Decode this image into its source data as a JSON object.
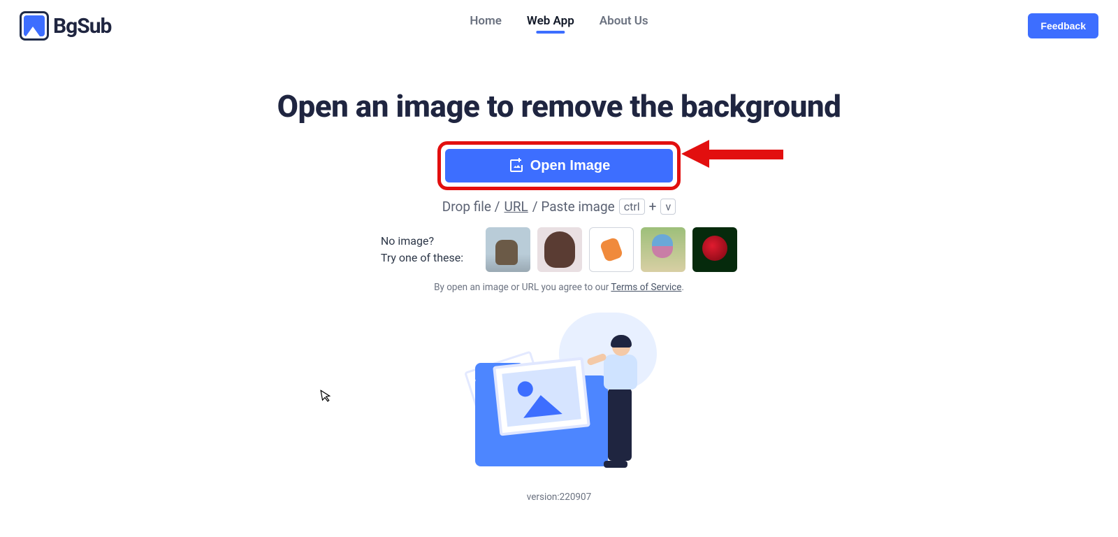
{
  "brand": {
    "name": "BgSub"
  },
  "nav": {
    "items": [
      {
        "label": "Home",
        "active": false
      },
      {
        "label": "Web App",
        "active": true
      },
      {
        "label": "About Us",
        "active": false
      }
    ],
    "feedback": "Feedback"
  },
  "hero": {
    "title": "Open an image to remove the background",
    "open_button": "Open Image",
    "drop_prefix": "Drop file / ",
    "url_label": "URL",
    "drop_mid": " / Paste image ",
    "kbd_ctrl": "ctrl",
    "kbd_plus": "+",
    "kbd_v": "v"
  },
  "samples": {
    "line1": "No image?",
    "line2": "Try one of these:",
    "thumbs": [
      "couple",
      "woman",
      "orange-object",
      "bird",
      "rose"
    ]
  },
  "tos": {
    "prefix": "By open an image or URL you agree to our ",
    "link": "Terms of Service",
    "suffix": "."
  },
  "version": "version:220907"
}
